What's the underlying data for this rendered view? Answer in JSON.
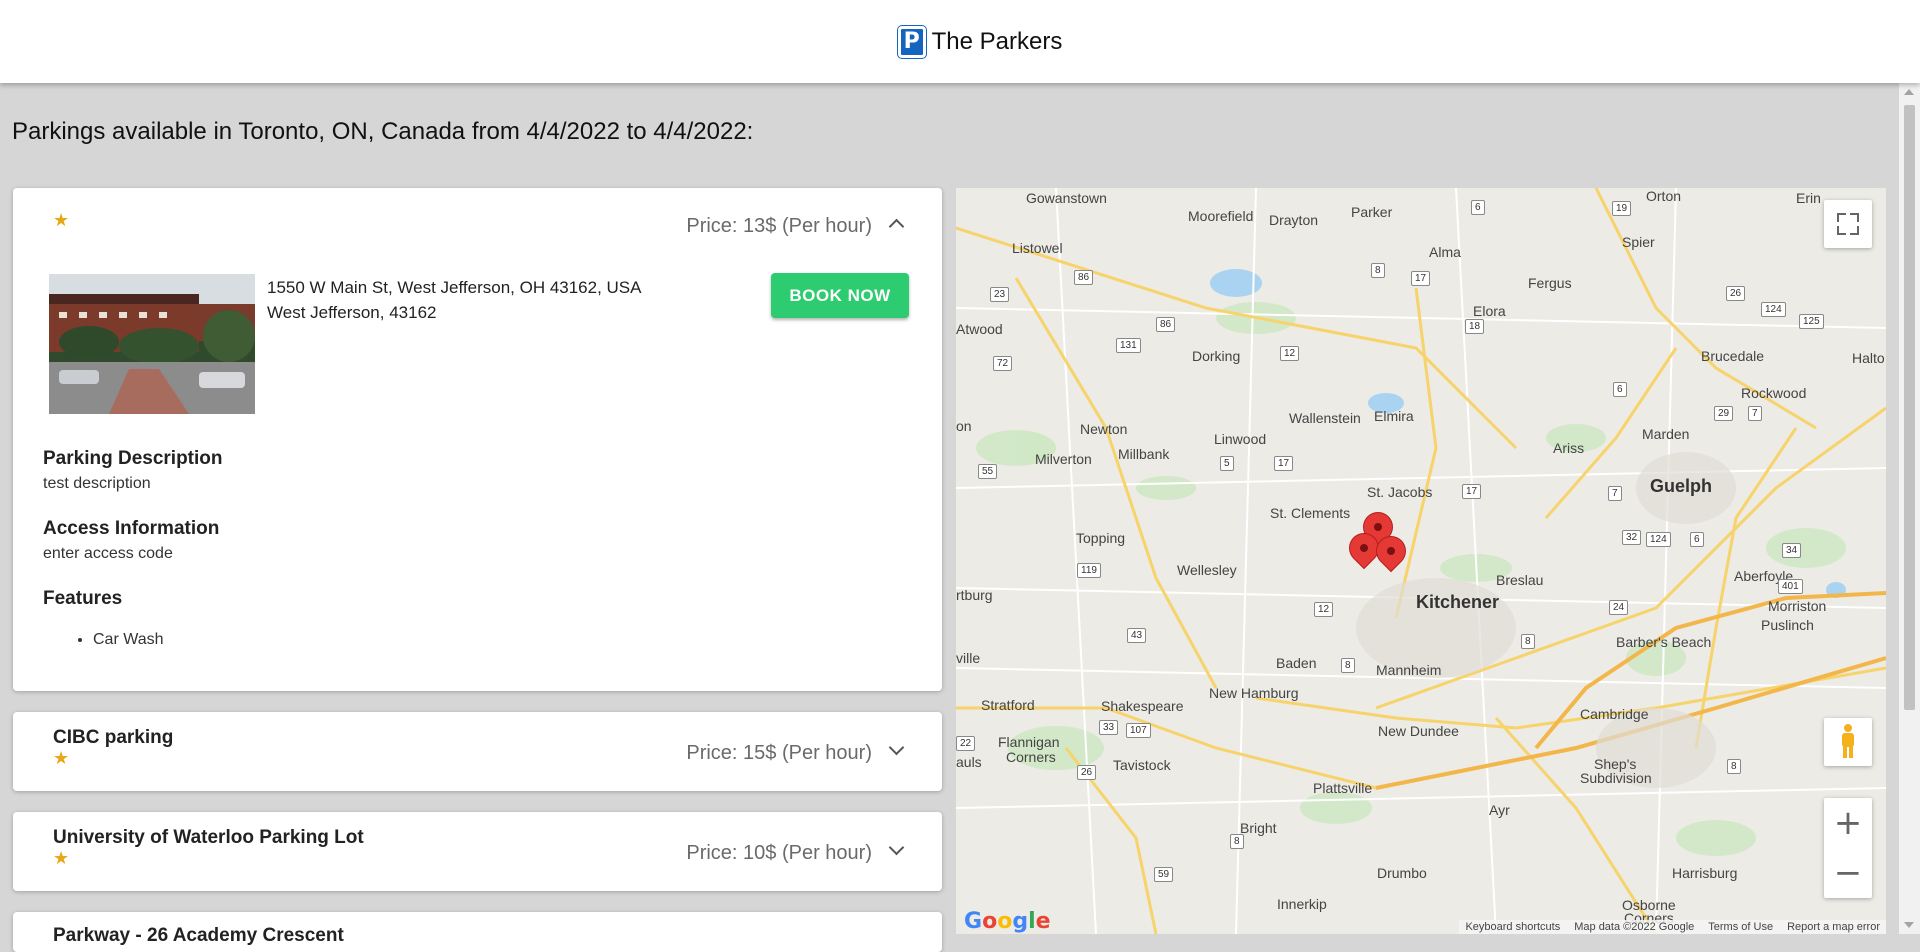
{
  "header": {
    "title": "The Parkers",
    "logo_letter": "P"
  },
  "page": {
    "heading": "Parkings available in Toronto, ON, Canada from 4/4/2022 to 4/4/2022:"
  },
  "listings": [
    {
      "name": "",
      "rating_stars": "★",
      "price": "Price: 13$ (Per hour)",
      "address_line1": "1550 W Main St, West Jefferson, OH 43162, USA",
      "address_line2": "West Jefferson, 43162",
      "book_label": "BOOK NOW",
      "description_title": "Parking Description",
      "description": "test description",
      "access_title": "Access Information",
      "access": "enter access code",
      "features_title": "Features",
      "features": [
        "Car Wash"
      ],
      "expanded": true
    },
    {
      "name": "CIBC parking",
      "rating_stars": "★",
      "price": "Price: 15$ (Per hour)",
      "expanded": false
    },
    {
      "name": "University of Waterloo Parking Lot",
      "rating_stars": "★",
      "price": "Price: 10$ (Per hour)",
      "expanded": false
    },
    {
      "name": "Parkway - 26 Academy Crescent",
      "expanded": false
    }
  ],
  "map": {
    "places": {
      "gowanstown": "Gowanstown",
      "moorefield": "Moorefield",
      "drayton": "Drayton",
      "parker": "Parker",
      "orton": "Orton",
      "erin": "Erin",
      "listowel": "Listowel",
      "alma": "Alma",
      "spier": "Spier",
      "fergus": "Fergus",
      "elora": "Elora",
      "atwood": "Atwood",
      "dorking": "Dorking",
      "brucedale": "Brucedale",
      "halto": "Halto",
      "rockwood": "Rockwood",
      "newton": "Newton",
      "linwood": "Linwood",
      "wallenstein": "Wallenstein",
      "elmira": "Elmira",
      "marden": "Marden",
      "on": "on",
      "milverton": "Milverton",
      "millbank": "Millbank",
      "ariss": "Ariss",
      "guelph": "Guelph",
      "st_jacobs": "St. Jacobs",
      "st_clements": "St. Clements",
      "topping": "Topping",
      "wellesley": "Wellesley",
      "breslau": "Breslau",
      "aberfoyle": "Aberfoyle",
      "kitchener": "Kitchener",
      "rtburg": "rtburg",
      "morriston": "Morriston",
      "puslinch": "Puslinch",
      "barbers_beach": "Barber's Beach",
      "ville": "ville",
      "baden": "Baden",
      "mannheim": "Mannheim",
      "stratford": "Stratford",
      "shakespeare": "Shakespeare",
      "new_hamburg": "New Hamburg",
      "cambridge": "Cambridge",
      "new_dundee": "New Dundee",
      "flannigan": "Flannigan",
      "corners": "Corners",
      "tavistock": "Tavistock",
      "shreps": "Shep's",
      "subdivision": "Subdivision",
      "auls": "auls",
      "plattsville": "Plattsville",
      "ayr": "Ayr",
      "bright": "Bright",
      "drumbo": "Drumbo",
      "harrisburg": "Harrisburg",
      "innerkip": "Innerkip",
      "osborne": "Osborne",
      "corners2": "Corners"
    },
    "shields": [
      "6",
      "19",
      "23",
      "86",
      "8",
      "17",
      "26",
      "124",
      "125",
      "72",
      "131",
      "86",
      "12",
      "18",
      "6",
      "29",
      "7",
      "55",
      "5",
      "17",
      "17",
      "7",
      "32",
      "124",
      "6",
      "34",
      "119",
      "401",
      "12",
      "24",
      "43",
      "8",
      "8",
      "22",
      "33",
      "107",
      "26",
      "8",
      "8",
      "59"
    ],
    "fullscreen_icon": "fullscreen-icon",
    "pegman_icon": "pegman-icon",
    "zoom_in": "+",
    "zoom_out": "−",
    "google_logo": "Google",
    "attribution": {
      "shortcuts": "Keyboard shortcuts",
      "data": "Map data ©2022 Google",
      "terms": "Terms of Use",
      "report": "Report a map error"
    }
  }
}
